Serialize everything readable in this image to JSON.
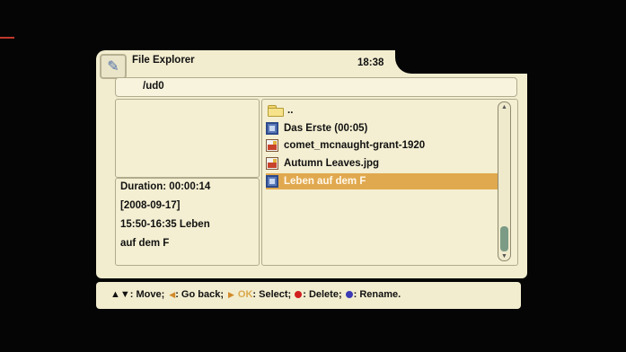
{
  "window": {
    "title": "File Explorer",
    "clock": "18:38"
  },
  "path": "/ud0",
  "info": {
    "lines": [
      "Duration: 00:00:14",
      "[2008-09-17]",
      "15:50-16:35 Leben",
      "auf dem F"
    ]
  },
  "files": [
    {
      "label": "..",
      "icon": "folder-icon"
    },
    {
      "label": "Das Erste (00:05)",
      "icon": "video-file-icon"
    },
    {
      "label": "comet_mcnaught-grant-1920",
      "icon": "image-file-icon"
    },
    {
      "label": "Autumn Leaves.jpg",
      "icon": "image-file-icon"
    },
    {
      "label": "Leben auf dem F",
      "icon": "video-file-icon",
      "selected": true
    }
  ],
  "help": {
    "move": "▲▼: Move;",
    "go_back": ": Go back;",
    "ok_key": "OK",
    "select": ": Select;",
    "delete": ": Delete;",
    "rename": ": Rename."
  },
  "colors": {
    "selection": "#e1a94f",
    "delete_key": "#d11f1f",
    "rename_key": "#3b3bb5"
  }
}
